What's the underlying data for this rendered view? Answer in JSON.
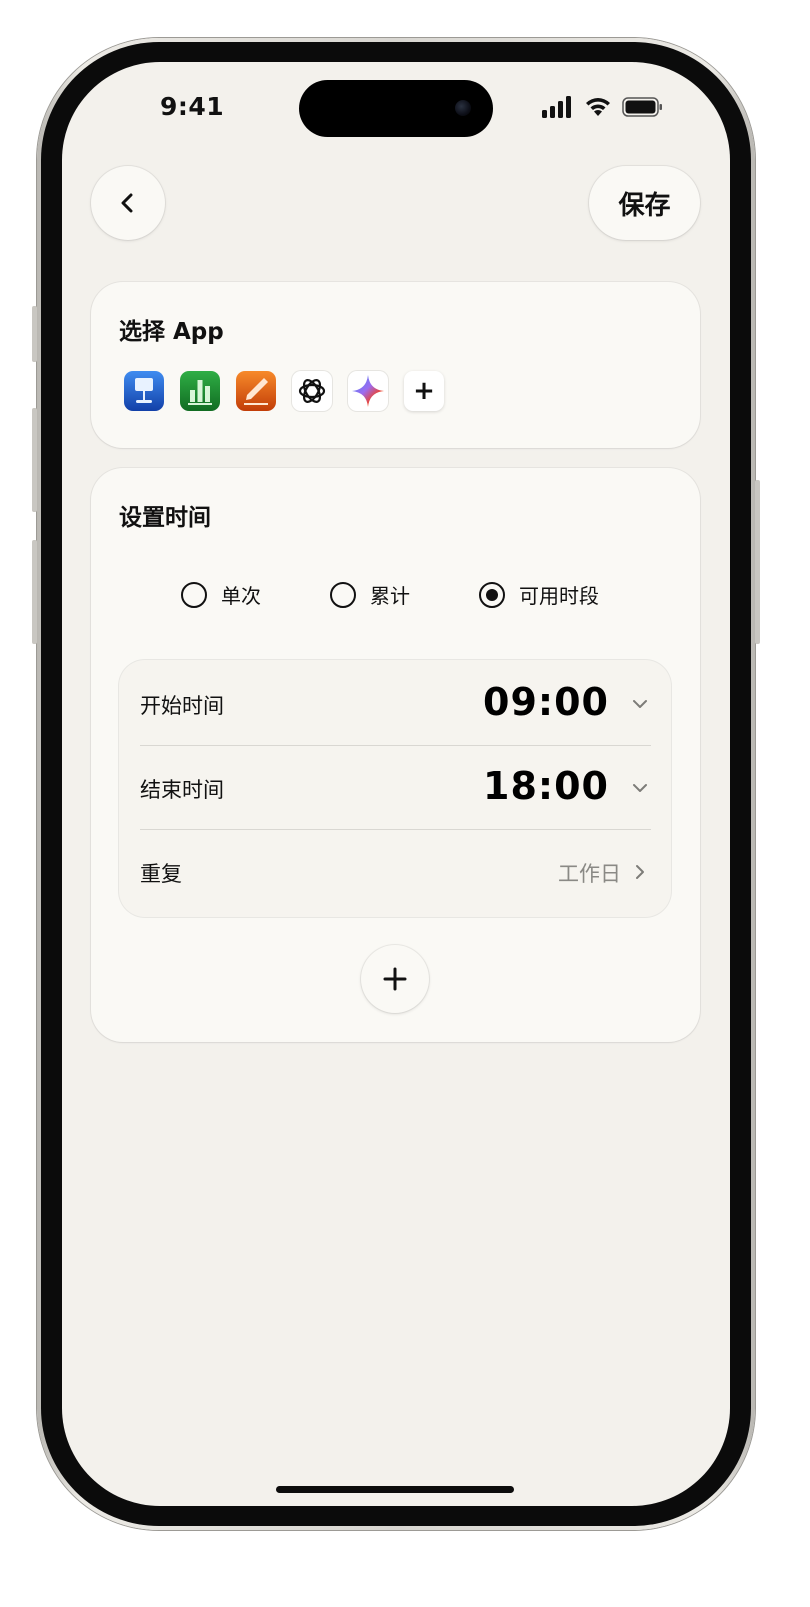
{
  "status_bar": {
    "time": "9:41"
  },
  "header": {
    "back_icon": "chevron-left-icon",
    "save_label": "保存"
  },
  "apps_card": {
    "title": "选择 App",
    "apps": [
      {
        "icon": "keynote-icon"
      },
      {
        "icon": "numbers-icon"
      },
      {
        "icon": "pages-icon"
      },
      {
        "icon": "chatgpt-icon"
      },
      {
        "icon": "gemini-icon"
      }
    ],
    "add_label": "+"
  },
  "time_card": {
    "title": "设置时间",
    "modes": [
      {
        "label": "单次",
        "selected": false
      },
      {
        "label": "累计",
        "selected": false
      },
      {
        "label": "可用时段",
        "selected": true
      }
    ],
    "start": {
      "label": "开始时间",
      "value": "09:00"
    },
    "end": {
      "label": "结束时间",
      "value": "18:00"
    },
    "repeat": {
      "label": "重复",
      "value": "工作日"
    },
    "add_icon": "plus-icon"
  },
  "colors": {
    "background": "#f3f1ec",
    "card": "#faf9f5",
    "text": "#111111",
    "muted": "#8a8985"
  }
}
